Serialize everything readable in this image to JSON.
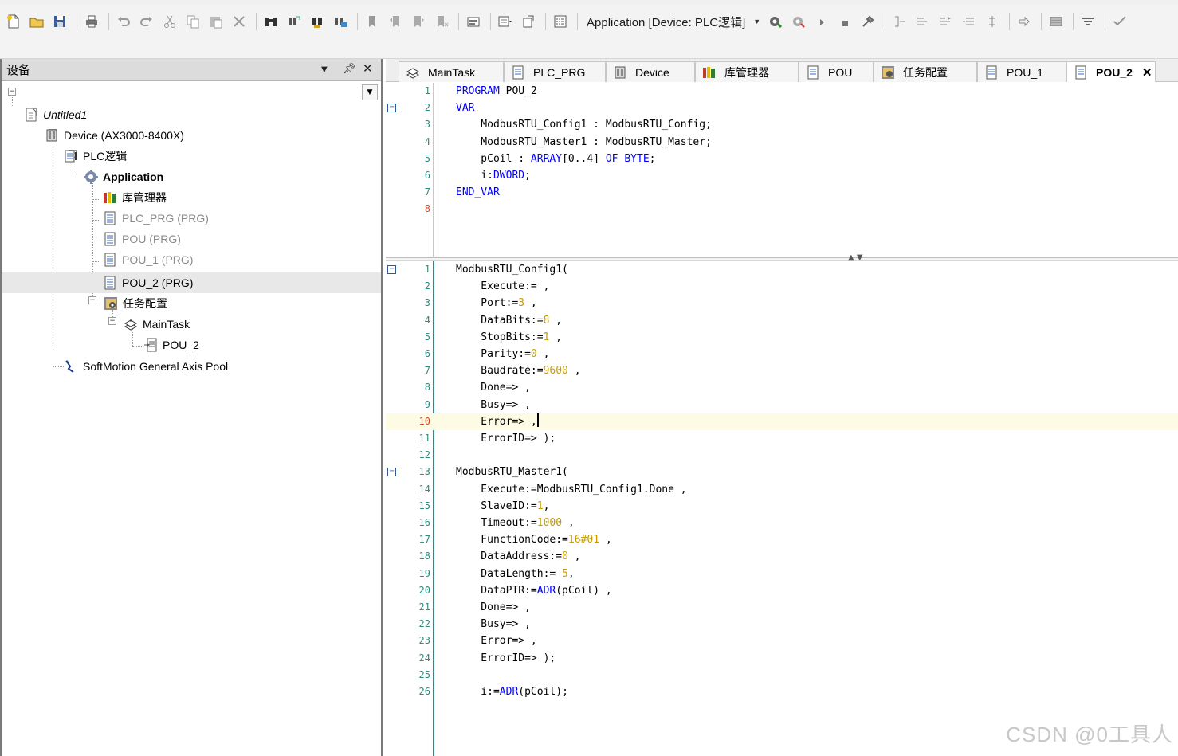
{
  "toolbar": {
    "application_selector": "Application [Device: PLC逻辑]",
    "icons": [
      "new-icon",
      "open-icon",
      "save-icon",
      "print-icon",
      "undo-icon",
      "redo-icon",
      "cut-icon",
      "copy-icon",
      "paste-icon",
      "delete-icon",
      "find-icon",
      "replace-icon",
      "find-in-project-icon",
      "browse-icon",
      "bookmark-icon",
      "bookmark-prev-icon",
      "bookmark-next-icon",
      "bookmark-clear-icon",
      "compile-icon",
      "build-icon",
      "output-icon",
      "config-icon",
      "login-icon",
      "logout-icon",
      "run-icon",
      "stop-icon",
      "tools-icon",
      "step-icon",
      "step-over-icon",
      "step-into-icon",
      "step-out-icon",
      "breakpoint-icon",
      "next-statement-icon",
      "monitor-icon",
      "filter-icon",
      "verify-icon"
    ]
  },
  "panel": {
    "title": "设备"
  },
  "tree": {
    "project": "Untitled1",
    "device": "Device (AX3000-8400X)",
    "plc_logic": "PLC逻辑",
    "application": "Application",
    "library_manager": "库管理器",
    "plc_prg": "PLC_PRG (PRG)",
    "pou": "POU (PRG)",
    "pou1": "POU_1 (PRG)",
    "pou2": "POU_2 (PRG)",
    "task_config": "任务配置",
    "main_task": "MainTask",
    "task_pou": "POU_2",
    "softmotion": "SoftMotion General Axis Pool"
  },
  "tabs": [
    {
      "label": "MainTask"
    },
    {
      "label": "PLC_PRG"
    },
    {
      "label": "Device"
    },
    {
      "label": "库管理器"
    },
    {
      "label": "POU"
    },
    {
      "label": "任务配置"
    },
    {
      "label": "POU_1"
    },
    {
      "label": "POU_2"
    }
  ],
  "declaration": {
    "lines": [
      {
        "n": "1",
        "tokens": [
          [
            "kw",
            "PROGRAM"
          ],
          [
            "id",
            " POU_2"
          ]
        ]
      },
      {
        "n": "2",
        "tokens": [
          [
            "kw",
            "VAR"
          ]
        ]
      },
      {
        "n": "3",
        "tokens": [
          [
            "id",
            "    ModbusRTU_Config1 : ModbusRTU_Config;"
          ]
        ]
      },
      {
        "n": "4",
        "tokens": [
          [
            "id",
            "    ModbusRTU_Master1 : ModbusRTU_Master;"
          ]
        ]
      },
      {
        "n": "5",
        "tokens": [
          [
            "id",
            "    pCoil : "
          ],
          [
            "kw",
            "ARRAY"
          ],
          [
            "id",
            "[0..4] "
          ],
          [
            "kw",
            "OF BYTE"
          ],
          [
            "id",
            ";"
          ]
        ]
      },
      {
        "n": "6",
        "tokens": [
          [
            "id",
            "    i:"
          ],
          [
            "kw",
            "DWORD"
          ],
          [
            "id",
            ";"
          ]
        ]
      },
      {
        "n": "7",
        "tokens": [
          [
            "kw",
            "END_VAR"
          ]
        ]
      },
      {
        "n": "8",
        "tokens": []
      }
    ]
  },
  "implementation": {
    "lines": [
      {
        "n": "1",
        "tokens": [
          [
            "id",
            "ModbusRTU_Config1("
          ]
        ]
      },
      {
        "n": "2",
        "tokens": [
          [
            "id",
            "    Execute:= ,"
          ]
        ]
      },
      {
        "n": "3",
        "tokens": [
          [
            "id",
            "    Port:="
          ],
          [
            "num",
            "3"
          ],
          [
            "id",
            " ,"
          ]
        ]
      },
      {
        "n": "4",
        "tokens": [
          [
            "id",
            "    DataBits:="
          ],
          [
            "num",
            "8"
          ],
          [
            "id",
            " ,"
          ]
        ]
      },
      {
        "n": "5",
        "tokens": [
          [
            "id",
            "    StopBits:="
          ],
          [
            "num",
            "1"
          ],
          [
            "id",
            " ,"
          ]
        ]
      },
      {
        "n": "6",
        "tokens": [
          [
            "id",
            "    Parity:="
          ],
          [
            "num",
            "0"
          ],
          [
            "id",
            " ,"
          ]
        ]
      },
      {
        "n": "7",
        "tokens": [
          [
            "id",
            "    Baudrate:="
          ],
          [
            "num",
            "9600"
          ],
          [
            "id",
            " ,"
          ]
        ]
      },
      {
        "n": "8",
        "tokens": [
          [
            "id",
            "    Done=> ,"
          ]
        ]
      },
      {
        "n": "9",
        "tokens": [
          [
            "id",
            "    Busy=> ,"
          ]
        ]
      },
      {
        "n": "10",
        "tokens": [
          [
            "id",
            "    Error=> ,"
          ]
        ]
      },
      {
        "n": "11",
        "tokens": [
          [
            "id",
            "    ErrorID=> );"
          ]
        ]
      },
      {
        "n": "12",
        "tokens": []
      },
      {
        "n": "13",
        "tokens": [
          [
            "id",
            "ModbusRTU_Master1("
          ]
        ]
      },
      {
        "n": "14",
        "tokens": [
          [
            "id",
            "    Execute:=ModbusRTU_Config1.Done ,"
          ]
        ]
      },
      {
        "n": "15",
        "tokens": [
          [
            "id",
            "    SlaveID:="
          ],
          [
            "num",
            "1"
          ],
          [
            "id",
            ","
          ]
        ]
      },
      {
        "n": "16",
        "tokens": [
          [
            "id",
            "    Timeout:="
          ],
          [
            "num",
            "1000"
          ],
          [
            "id",
            " ,"
          ]
        ]
      },
      {
        "n": "17",
        "tokens": [
          [
            "id",
            "    FunctionCode:="
          ],
          [
            "num",
            "16#01"
          ],
          [
            "id",
            " ,"
          ]
        ]
      },
      {
        "n": "18",
        "tokens": [
          [
            "id",
            "    DataAddress:="
          ],
          [
            "num",
            "0"
          ],
          [
            "id",
            " ,"
          ]
        ]
      },
      {
        "n": "19",
        "tokens": [
          [
            "id",
            "    DataLength:= "
          ],
          [
            "num",
            "5"
          ],
          [
            "id",
            ","
          ]
        ]
      },
      {
        "n": "20",
        "tokens": [
          [
            "id",
            "    DataPTR:="
          ],
          [
            "kw",
            "ADR"
          ],
          [
            "id",
            "(pCoil) ,"
          ]
        ]
      },
      {
        "n": "21",
        "tokens": [
          [
            "id",
            "    Done=> ,"
          ]
        ]
      },
      {
        "n": "22",
        "tokens": [
          [
            "id",
            "    Busy=> ,"
          ]
        ]
      },
      {
        "n": "23",
        "tokens": [
          [
            "id",
            "    Error=> ,"
          ]
        ]
      },
      {
        "n": "24",
        "tokens": [
          [
            "id",
            "    ErrorID=> );"
          ]
        ]
      },
      {
        "n": "25",
        "tokens": []
      },
      {
        "n": "26",
        "tokens": [
          [
            "id",
            "    i:="
          ],
          [
            "kw",
            "ADR"
          ],
          [
            "id",
            "(pCoil);"
          ]
        ]
      }
    ]
  },
  "watermark": "CSDN @0工具人"
}
